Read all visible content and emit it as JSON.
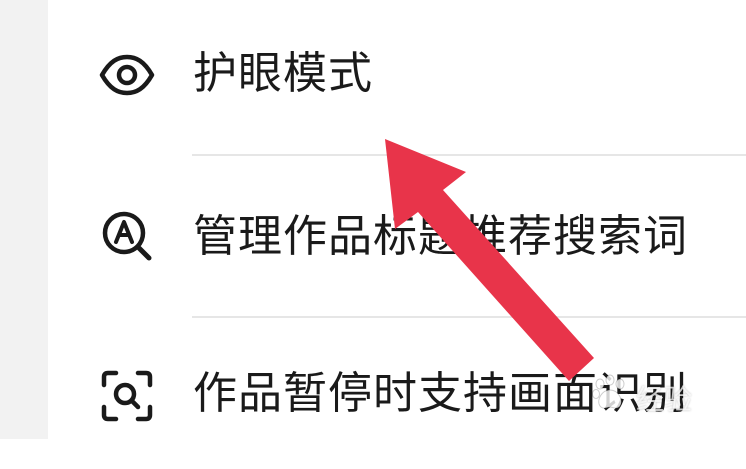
{
  "settings_menu": {
    "items": [
      {
        "icon": "eye-icon",
        "label": "护眼模式"
      },
      {
        "icon": "search-a-icon",
        "label": "管理作品标题推荐搜索词"
      },
      {
        "icon": "scan-search-icon",
        "label": "作品暂停时支持画面识别"
      }
    ]
  },
  "overlay": {
    "annotation": "red-arrow",
    "arrow_color": "#e8344a"
  },
  "watermark": {
    "text": "经验",
    "icon": "baidu-paw-icon"
  },
  "colors": {
    "background": "#ffffff",
    "left_strip": "#f2f2f2",
    "text": "#1a1a1a",
    "divider": "#e6e6e6",
    "icon": "#1a1a1a"
  }
}
